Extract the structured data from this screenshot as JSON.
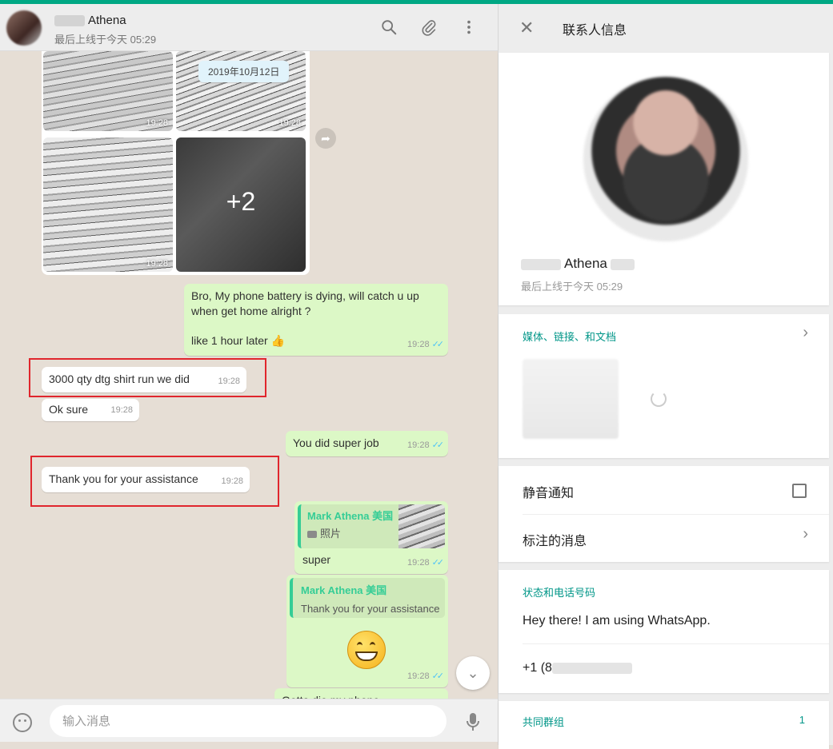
{
  "chat": {
    "header": {
      "name": "Athena",
      "status": "最后上线于今天 05:29"
    },
    "date_chip": "2019年10月12日",
    "image_grid": {
      "times": [
        "19:28",
        "19:28",
        "19:28"
      ],
      "more_count": "+2"
    },
    "messages": [
      {
        "dir": "out",
        "text": "Bro, My phone battery is dying, will catch u up when get home alright ?",
        "text2": "like 1 hour later 👍",
        "time": "19:28"
      },
      {
        "dir": "in",
        "text": "3000 qty dtg shirt run we did",
        "time": "19:28"
      },
      {
        "dir": "in",
        "text": "Ok sure",
        "time": "19:28"
      },
      {
        "dir": "out",
        "text": "You did super job",
        "time": "19:28"
      },
      {
        "dir": "in",
        "text": "Thank you for your assistance",
        "time": "19:28"
      },
      {
        "dir": "out",
        "quote_name": "Mark Athena 美国",
        "quote_text": "照片",
        "text": "super",
        "time": "19:28"
      },
      {
        "dir": "out",
        "quote_name": "Mark Athena 美国",
        "quote_text": "Thank you for your assistance",
        "time": "19:28"
      },
      {
        "dir": "out",
        "text": "Gotta die my phone"
      }
    ],
    "compose": {
      "placeholder": "输入消息"
    }
  },
  "contact": {
    "title": "联系人信息",
    "name": "Athena",
    "last_seen": "最后上线于今天 05:29",
    "media_label": "媒体、链接、和文档",
    "mute_label": "静音通知",
    "starred_label": "标注的消息",
    "status_section_label": "状态和电话号码",
    "status_text": "Hey there! I am using WhatsApp.",
    "phone_prefix": "+1 (8",
    "groups_label": "共同群组",
    "groups_count": "1"
  },
  "colors": {
    "accent": "#00a884",
    "outgoing_bubble": "#dcf8c6",
    "incoming_bubble": "#ffffff",
    "highlight_box": "#e0262d",
    "section_label": "#009688",
    "read_ticks": "#4fc3f7"
  },
  "icons": [
    "search-icon",
    "paperclip-icon",
    "menu-dots-icon",
    "forward-icon",
    "chevron-down-icon",
    "emoji-icon",
    "microphone-icon",
    "close-icon",
    "chevron-right-icon",
    "camera-icon",
    "checkbox-icon"
  ]
}
